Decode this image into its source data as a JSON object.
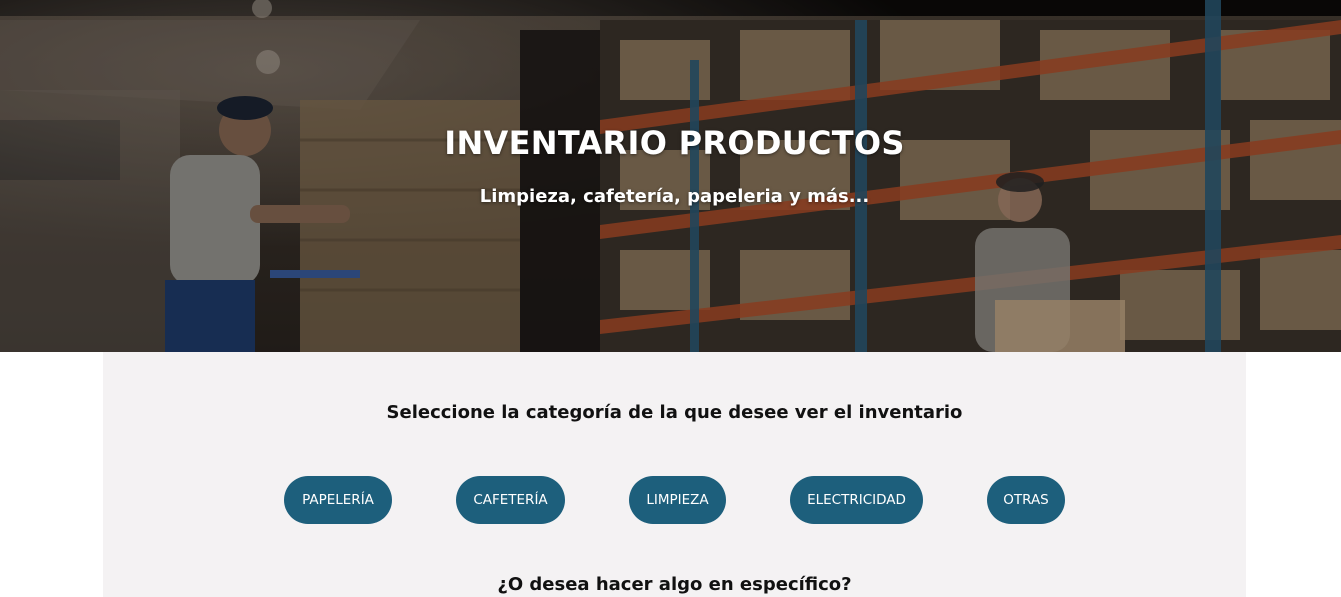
{
  "hero": {
    "title": "INVENTARIO PRODUCTOS",
    "subtitle": "Limpieza, cafetería, papeleria y más...",
    "background_image": "warehouse-workers-photo"
  },
  "categories": {
    "heading": "Seleccione la categoría de la que desee ver el inventario",
    "buttons": [
      {
        "label": "PAPELERÍA"
      },
      {
        "label": "CAFETERÍA"
      },
      {
        "label": "LIMPIEZA"
      },
      {
        "label": "ELECTRICIDAD"
      },
      {
        "label": "OTRAS"
      }
    ],
    "button_color": "#1d5f7c",
    "footer_question": "¿O desea hacer algo en específico?"
  },
  "colors": {
    "panel_background": "#f4f2f3",
    "page_background": "#ffffff"
  }
}
